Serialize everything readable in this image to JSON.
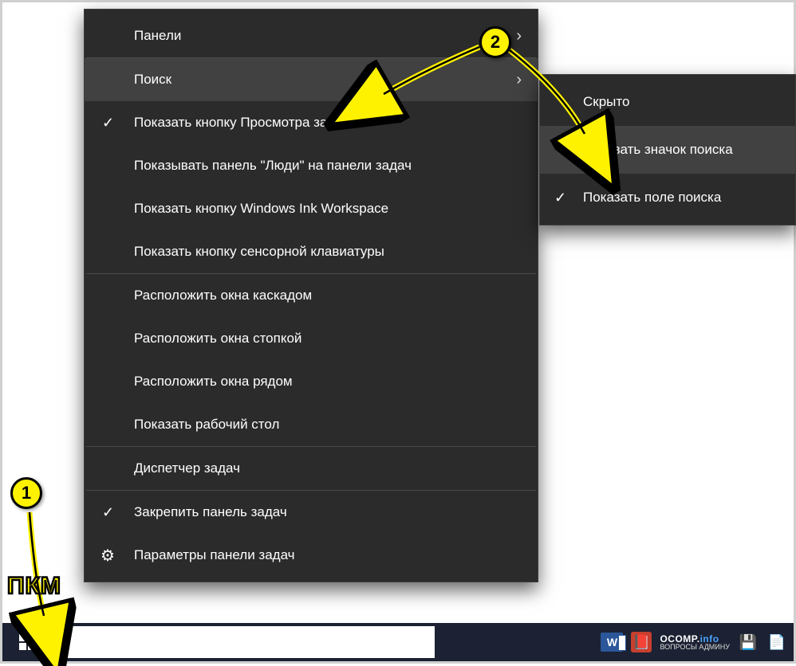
{
  "menu": {
    "panels": "Панели",
    "search": "Поиск",
    "taskview": "Показать кнопку Просмотра задач",
    "people": "Показывать панель \"Люди\" на панели задач",
    "ink": "Показать кнопку Windows Ink Workspace",
    "touchkb": "Показать кнопку сенсорной клавиатуры",
    "cascade": "Расположить окна каскадом",
    "stacked": "Расположить окна стопкой",
    "sidebyside": "Расположить окна рядом",
    "showdesktop": "Показать рабочий стол",
    "taskmgr": "Диспетчер задач",
    "lock": "Закрепить панель задач",
    "settings": "Параметры панели задач"
  },
  "submenu": {
    "hidden": "Скрыто",
    "showicon": "Показать значок поиска",
    "showfield": "Показать поле поиска"
  },
  "annotations": {
    "badge1": "1",
    "badge2": "2",
    "pkm": "ПКМ"
  },
  "branding": {
    "ocomp": "OCOMP.",
    "info": "info",
    "sub": "ВОПРОСЫ АДМИНУ",
    "word": "W"
  }
}
